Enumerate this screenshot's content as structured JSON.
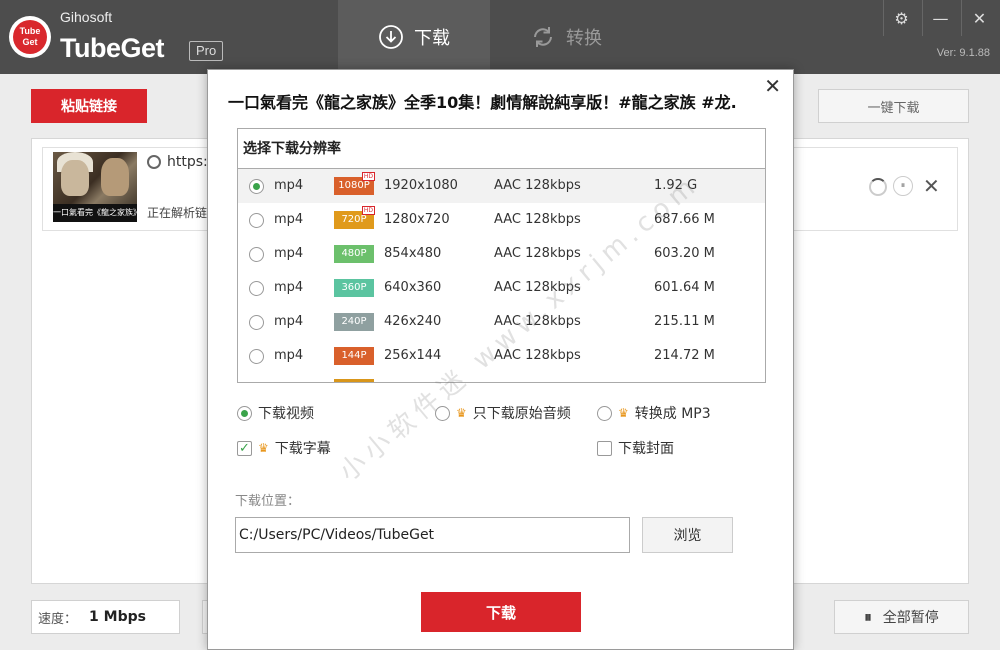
{
  "app": {
    "company": "Gihosoft",
    "product": "TubeGet",
    "edition": "Pro",
    "logo_text": "Tube\nGet",
    "version": "Ver: 9.1.88"
  },
  "tabs": [
    {
      "label": "下载",
      "icon": "download-circle-icon",
      "active": true
    },
    {
      "label": "转换",
      "icon": "convert-arrows-icon",
      "active": false
    }
  ],
  "window_controls": {
    "settings": "⚙",
    "minimize": "—",
    "close": "✕"
  },
  "toolbar": {
    "paste_label": "粘贴链接",
    "onekey_label": "一键下载"
  },
  "download_item": {
    "url": "https://",
    "status": "正在解析链",
    "thumb_caption": "一口氣看完《龍之家族》",
    "remove": "✕",
    "pause": "⏸"
  },
  "footer": {
    "speed_label": "速度：",
    "speed_value": "1 Mbps",
    "pause_all_label": "全部暂停",
    "pause_icon": "⏸"
  },
  "dialog": {
    "close": "✕",
    "title": "一口氣看完《龍之家族》全季10集！劇情解說純享版！#龍之家族 #龙..",
    "resolution_header": "选择下载分辨率",
    "resolutions": [
      {
        "format": "mp4",
        "badge": "1080P",
        "hd": "HD",
        "badge_color": "#d9602b",
        "dimensions": "1920x1080",
        "audio": "AAC 128kbps",
        "size": "1.92 G",
        "selected": true
      },
      {
        "format": "mp4",
        "badge": "720P",
        "hd": "HD",
        "badge_color": "#e09a1c",
        "dimensions": "1280x720",
        "audio": "AAC 128kbps",
        "size": "687.66 M",
        "selected": false
      },
      {
        "format": "mp4",
        "badge": "480P",
        "hd": "",
        "badge_color": "#6cc06c",
        "dimensions": "854x480",
        "audio": "AAC 128kbps",
        "size": "603.20 M",
        "selected": false
      },
      {
        "format": "mp4",
        "badge": "360P",
        "hd": "",
        "badge_color": "#5bc4a0",
        "dimensions": "640x360",
        "audio": "AAC 128kbps",
        "size": "601.64 M",
        "selected": false
      },
      {
        "format": "mp4",
        "badge": "240P",
        "hd": "",
        "badge_color": "#8fa0a0",
        "dimensions": "426x240",
        "audio": "AAC 128kbps",
        "size": "215.11 M",
        "selected": false
      },
      {
        "format": "mp4",
        "badge": "144P",
        "hd": "",
        "badge_color": "#d9602b",
        "dimensions": "256x144",
        "audio": "AAC 128kbps",
        "size": "214.72 M",
        "selected": false
      }
    ],
    "options": {
      "download_video": "下载视频",
      "audio_only": "只下载原始音频",
      "convert_mp3": "转换成 MP3",
      "subtitles": "下载字幕",
      "cover": "下载封面",
      "crown": "♛"
    },
    "location_label": "下载位置：",
    "path": "C:/Users/PC/Videos/TubeGet",
    "browse_label": "浏览",
    "download_label": "下载"
  },
  "watermark": "小小软件迷  www.xxrjm.com"
}
